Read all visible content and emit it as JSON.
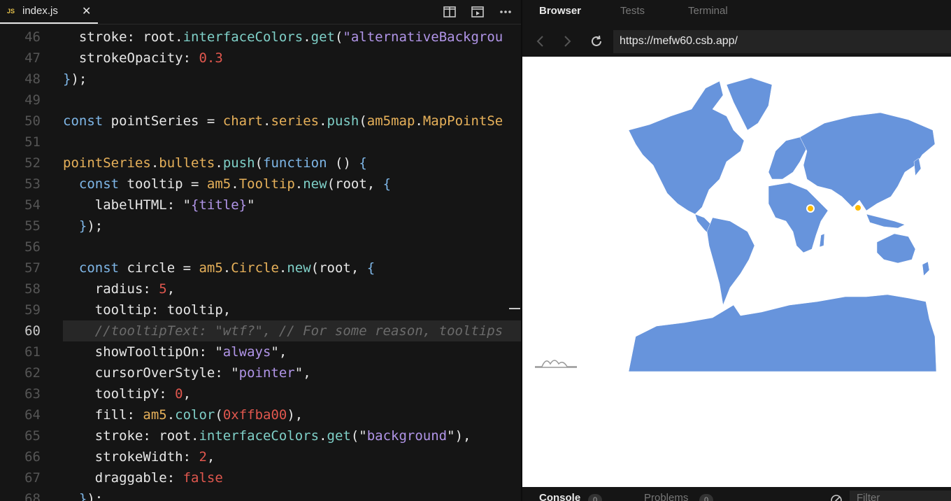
{
  "editor": {
    "tab": {
      "badge": "JS",
      "filename": "index.js",
      "close_glyph": "✕"
    },
    "actions": [
      "split-editor-icon",
      "preview-icon",
      "more-icon"
    ],
    "active_line": 60,
    "lines": [
      {
        "n": "46",
        "tokens": [
          [
            "prop",
            "  stroke: root."
          ],
          [
            "fn",
            "interfaceColors"
          ],
          [
            "prop",
            "."
          ],
          [
            "fn",
            "get"
          ],
          [
            "prop",
            "("
          ],
          [
            "str",
            "\"alternativeBackgrou"
          ]
        ]
      },
      {
        "n": "47",
        "tokens": [
          [
            "prop",
            "  strokeOpacity: "
          ],
          [
            "num",
            "0.3"
          ]
        ]
      },
      {
        "n": "48",
        "tokens": [
          [
            "pn",
            "}"
          ],
          [
            "prop",
            ");"
          ]
        ]
      },
      {
        "n": "49",
        "tokens": []
      },
      {
        "n": "50",
        "tokens": [
          [
            "kw",
            "const"
          ],
          [
            "prop",
            " pointSeries = "
          ],
          [
            "cls",
            "chart"
          ],
          [
            "prop",
            "."
          ],
          [
            "cls",
            "series"
          ],
          [
            "prop",
            "."
          ],
          [
            "fn",
            "push"
          ],
          [
            "prop",
            "("
          ],
          [
            "cls",
            "am5map"
          ],
          [
            "prop",
            "."
          ],
          [
            "cls",
            "MapPointSe"
          ]
        ]
      },
      {
        "n": "51",
        "tokens": []
      },
      {
        "n": "52",
        "tokens": [
          [
            "cls",
            "pointSeries"
          ],
          [
            "prop",
            "."
          ],
          [
            "cls",
            "bullets"
          ],
          [
            "prop",
            "."
          ],
          [
            "fn",
            "push"
          ],
          [
            "prop",
            "("
          ],
          [
            "kw",
            "function"
          ],
          [
            "prop",
            " () "
          ],
          [
            "pn",
            "{"
          ]
        ]
      },
      {
        "n": "53",
        "tokens": [
          [
            "kw",
            "  const"
          ],
          [
            "prop",
            " tooltip = "
          ],
          [
            "cls",
            "am5"
          ],
          [
            "prop",
            "."
          ],
          [
            "cls",
            "Tooltip"
          ],
          [
            "prop",
            "."
          ],
          [
            "fn",
            "new"
          ],
          [
            "prop",
            "(root, "
          ],
          [
            "pn",
            "{"
          ]
        ]
      },
      {
        "n": "54",
        "tokens": [
          [
            "prop",
            "    labelHTML: \""
          ],
          [
            "str",
            "{title}"
          ],
          [
            "prop",
            "\""
          ]
        ]
      },
      {
        "n": "55",
        "tokens": [
          [
            "pn",
            "  }"
          ],
          [
            "prop",
            ");"
          ]
        ]
      },
      {
        "n": "56",
        "tokens": []
      },
      {
        "n": "57",
        "tokens": [
          [
            "kw",
            "  const"
          ],
          [
            "prop",
            " circle = "
          ],
          [
            "cls",
            "am5"
          ],
          [
            "prop",
            "."
          ],
          [
            "cls",
            "Circle"
          ],
          [
            "prop",
            "."
          ],
          [
            "fn",
            "new"
          ],
          [
            "prop",
            "(root, "
          ],
          [
            "pn",
            "{"
          ]
        ]
      },
      {
        "n": "58",
        "tokens": [
          [
            "prop",
            "    radius: "
          ],
          [
            "num",
            "5"
          ],
          [
            "prop",
            ","
          ]
        ]
      },
      {
        "n": "59",
        "tokens": [
          [
            "prop",
            "    tooltip: tooltip,"
          ]
        ]
      },
      {
        "n": "60",
        "tokens": [
          [
            "cm",
            "    //tooltipText: \"wtf?\", // For some reason, tooltips"
          ]
        ]
      },
      {
        "n": "61",
        "tokens": [
          [
            "prop",
            "    showTooltipOn: \""
          ],
          [
            "str",
            "always"
          ],
          [
            "prop",
            "\","
          ]
        ]
      },
      {
        "n": "62",
        "tokens": [
          [
            "prop",
            "    cursorOverStyle: \""
          ],
          [
            "str",
            "pointer"
          ],
          [
            "prop",
            "\","
          ]
        ]
      },
      {
        "n": "63",
        "tokens": [
          [
            "prop",
            "    tooltipY: "
          ],
          [
            "num",
            "0"
          ],
          [
            "prop",
            ","
          ]
        ]
      },
      {
        "n": "64",
        "tokens": [
          [
            "prop",
            "    fill: "
          ],
          [
            "cls",
            "am5"
          ],
          [
            "prop",
            "."
          ],
          [
            "fn",
            "color"
          ],
          [
            "prop",
            "("
          ],
          [
            "num",
            "0xffba00"
          ],
          [
            "prop",
            "),"
          ]
        ]
      },
      {
        "n": "65",
        "tokens": [
          [
            "prop",
            "    stroke: root."
          ],
          [
            "fn",
            "interfaceColors"
          ],
          [
            "prop",
            "."
          ],
          [
            "fn",
            "get"
          ],
          [
            "prop",
            "(\""
          ],
          [
            "str",
            "background"
          ],
          [
            "prop",
            "\"),"
          ]
        ]
      },
      {
        "n": "66",
        "tokens": [
          [
            "prop",
            "    strokeWidth: "
          ],
          [
            "num",
            "2"
          ],
          [
            "prop",
            ","
          ]
        ]
      },
      {
        "n": "67",
        "tokens": [
          [
            "prop",
            "    draggable: "
          ],
          [
            "num",
            "false"
          ]
        ]
      },
      {
        "n": "68",
        "tokens": [
          [
            "pn",
            "  }"
          ],
          [
            "prop",
            ");"
          ]
        ]
      }
    ]
  },
  "browser": {
    "tabs": [
      "Browser",
      "Tests",
      "Terminal"
    ],
    "active_tab": "Browser",
    "url": "https://mefw60.csb.app/",
    "nav_icons": [
      "back-icon",
      "forward-icon",
      "refresh-icon"
    ],
    "map": {
      "land_color": "#6794dc",
      "point_color": "#ffba00",
      "points": [
        {
          "name": "east-africa-point"
        },
        {
          "name": "india-point"
        }
      ]
    },
    "console": {
      "tabs": [
        {
          "label": "Console",
          "count": "0"
        },
        {
          "label": "Problems",
          "count": "0"
        }
      ],
      "filter_placeholder": "Filter"
    }
  }
}
